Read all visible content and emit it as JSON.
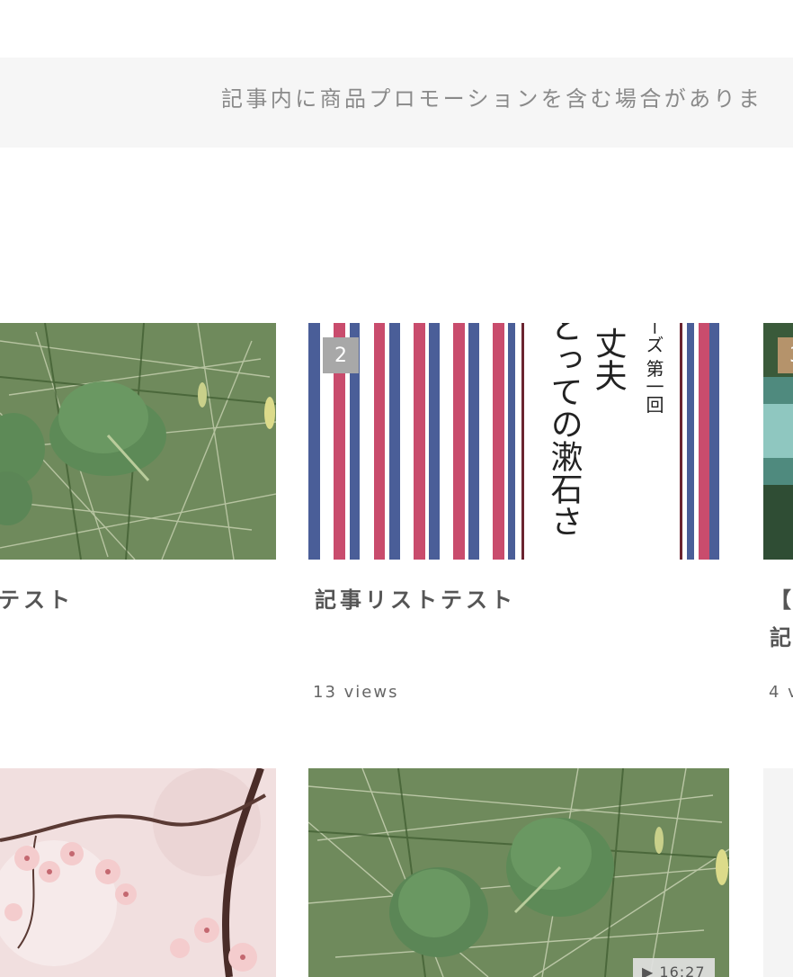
{
  "promo": {
    "text": "記事内に商品プロモーションを含む場合がありま"
  },
  "cards": [
    {
      "title": "テスト",
      "rank": "",
      "views": ""
    },
    {
      "title": "記事リストテスト",
      "rank": "2",
      "views": "13 views"
    },
    {
      "title": "【",
      "title_line2": "記",
      "rank": "3",
      "views": "4 v"
    }
  ],
  "second_row": [
    {
      "duration": "▶ 16:27"
    }
  ],
  "thumb2_text": {
    "col1": "ーズ 第一回",
    "col2": "丈夫",
    "col3": "とっての漱石さ"
  },
  "colors": {
    "rank_gray": "#a8a8a8",
    "rank_brown": "#b5936b",
    "stripe_red": "#c94c6d",
    "stripe_blue": "#4a5e98",
    "stripe_dark": "#6b2430"
  }
}
